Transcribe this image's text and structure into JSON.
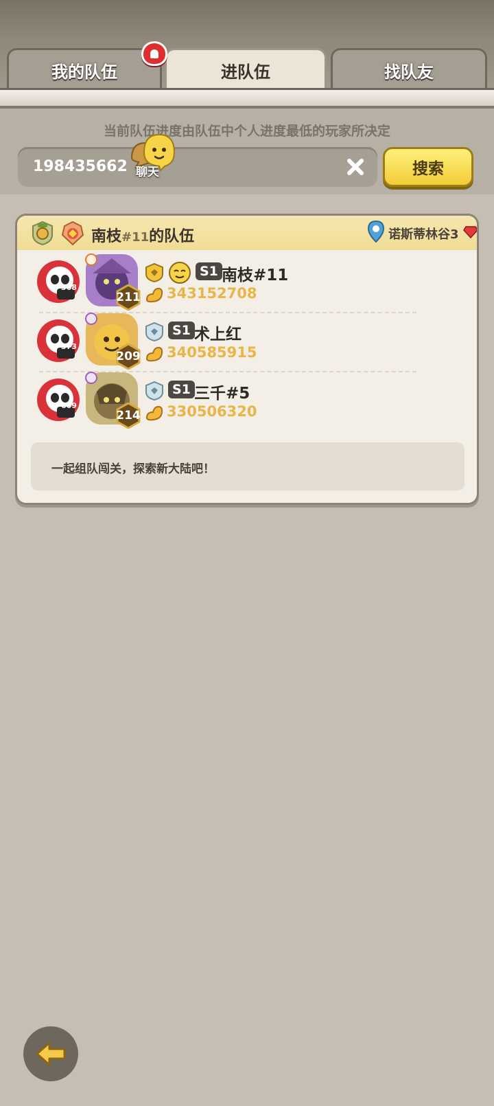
{
  "tabs": [
    {
      "label": "我的队伍",
      "active": false
    },
    {
      "label": "进队伍",
      "active": true
    },
    {
      "label": "找队友",
      "active": false
    }
  ],
  "hint": "当前队伍进度由队伍中个人进度最低的玩家所决定",
  "search": {
    "value": "198435662",
    "button": "搜索"
  },
  "chat": {
    "label": "聊天"
  },
  "team": {
    "name_prefix": "南枝",
    "name_tag": "#11",
    "name_suffix": "的队伍",
    "location": "诺斯蒂林谷3",
    "members": [
      {
        "pet_level": "568",
        "hero_level": "211",
        "season": "S1",
        "name": "南枝#11",
        "power": "343152708"
      },
      {
        "pet_level": "573",
        "hero_level": "209",
        "season": "S1",
        "name": "术上红",
        "power": "340585915"
      },
      {
        "pet_level": "609",
        "hero_level": "214",
        "season": "S1",
        "name": "三千#5",
        "power": "330506320"
      }
    ],
    "message": "一起组队闯关，探索新大陆吧！"
  },
  "colors": {
    "background": "#c6beb2",
    "power": "#e8b549",
    "search_button": "#f2cd3a",
    "header": "#efdc95"
  }
}
